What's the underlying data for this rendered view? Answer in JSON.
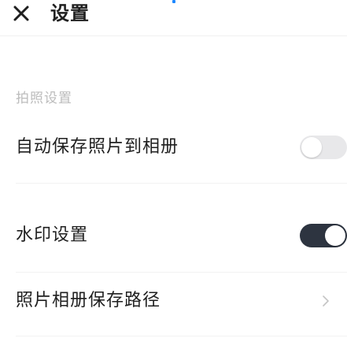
{
  "header": {
    "title": "设置",
    "close_icon": "close-icon"
  },
  "colors": {
    "accent": "#1e88ff",
    "toggle_on": "#2d3440",
    "toggle_off": "#e8e8ea",
    "text_primary": "#1f1f1f",
    "text_secondary": "#bcbcbc"
  },
  "sections": [
    {
      "label": "拍照设置",
      "items": [
        {
          "label": "自动保存照片到相册",
          "control": "toggle",
          "state": "off"
        },
        {
          "label": "水印设置",
          "control": "toggle",
          "state": "on"
        },
        {
          "label": "照片相册保存路径",
          "control": "chevron-right-icon"
        }
      ]
    }
  ]
}
